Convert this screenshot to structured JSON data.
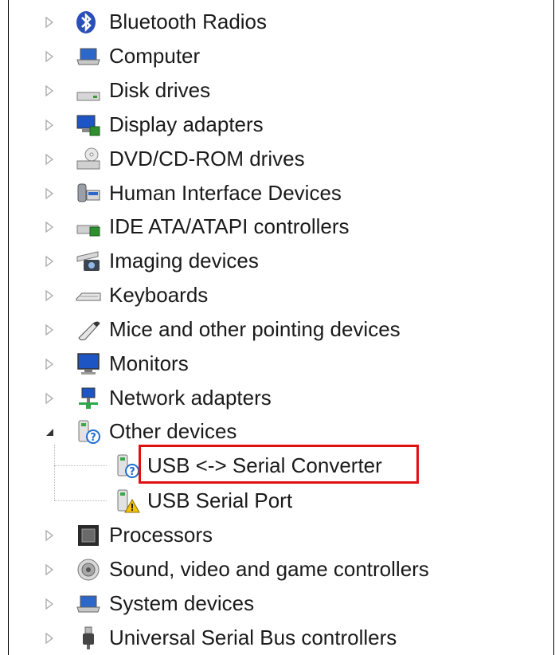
{
  "tree": {
    "categories": [
      {
        "label": "Bluetooth Radios",
        "icon": "bluetooth-icon"
      },
      {
        "label": "Computer",
        "icon": "computer-icon"
      },
      {
        "label": "Disk drives",
        "icon": "disk-drive-icon"
      },
      {
        "label": "Display adapters",
        "icon": "display-adapter-icon"
      },
      {
        "label": "DVD/CD-ROM drives",
        "icon": "dvd-drive-icon"
      },
      {
        "label": "Human Interface Devices",
        "icon": "hid-icon"
      },
      {
        "label": "IDE ATA/ATAPI controllers",
        "icon": "ide-controller-icon"
      },
      {
        "label": "Imaging devices",
        "icon": "camera-icon"
      },
      {
        "label": "Keyboards",
        "icon": "keyboard-icon"
      },
      {
        "label": "Mice and other pointing devices",
        "icon": "mouse-icon"
      },
      {
        "label": "Monitors",
        "icon": "monitor-icon"
      },
      {
        "label": "Network adapters",
        "icon": "network-adapter-icon"
      },
      {
        "label": "Other devices",
        "icon": "unknown-device-icon",
        "expanded": true
      },
      {
        "label": "Processors",
        "icon": "processor-icon"
      },
      {
        "label": "Sound, video and game controllers",
        "icon": "speaker-icon"
      },
      {
        "label": "System devices",
        "icon": "system-device-icon"
      },
      {
        "label": "Universal Serial Bus controllers",
        "icon": "usb-plug-icon"
      }
    ],
    "other_devices_children": [
      {
        "label": "USB <-> Serial Converter",
        "icon": "unknown-device-icon",
        "highlighted": true
      },
      {
        "label": "USB Serial Port",
        "icon": "warning-device-icon"
      }
    ]
  },
  "colors": {
    "highlight_border": "#e01010",
    "warning": "#f5c400",
    "help_blue": "#1e6fd0"
  }
}
